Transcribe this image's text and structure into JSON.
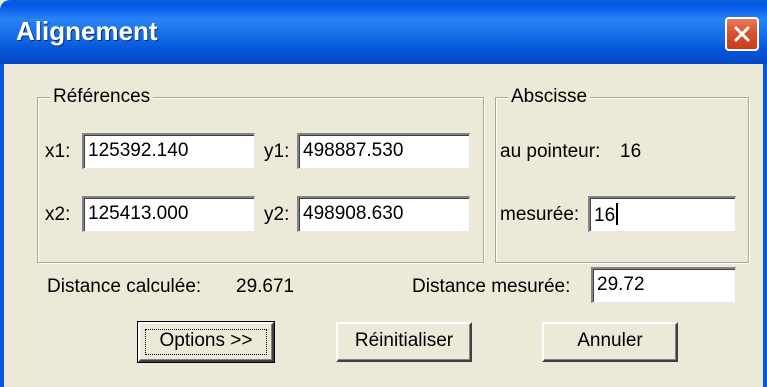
{
  "window": {
    "title": "Alignement"
  },
  "references": {
    "legend": "Références",
    "x1_label": "x1:",
    "x1_value": "125392.140",
    "y1_label": "y1:",
    "y1_value": "498887.530",
    "x2_label": "x2:",
    "x2_value": "125413.000",
    "y2_label": "y2:",
    "y2_value": "498908.630"
  },
  "abscisse": {
    "legend": "Abscisse",
    "pointer_label": "au pointeur:",
    "pointer_value": "16",
    "measured_label": "mesurée:",
    "measured_value": "16"
  },
  "distance": {
    "calculated_label": "Distance calculée:",
    "calculated_value": "29.671",
    "measured_label": "Distance mesurée:",
    "measured_value": "29.72"
  },
  "buttons": {
    "options": "Options >>",
    "reset": "Réinitialiser",
    "cancel": "Annuler"
  },
  "colors": {
    "titlebar": "#0058e6",
    "dialog_bg": "#ece9d8",
    "close_button": "#d8532e"
  },
  "icons": {
    "close": "close-icon"
  }
}
